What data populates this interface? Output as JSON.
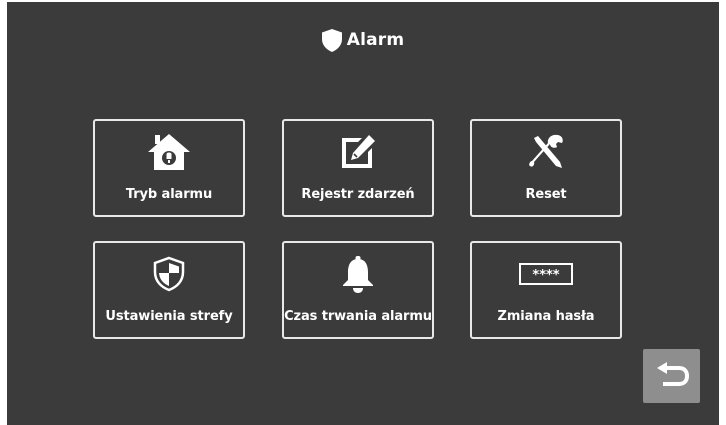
{
  "header": {
    "title": "Alarm",
    "icon": "shield-icon"
  },
  "tiles": [
    {
      "label": "Tryb alarmu",
      "icon": "house-alarm-icon"
    },
    {
      "label": "Rejestr zdarzeń",
      "icon": "edit-note-icon"
    },
    {
      "label": "Reset",
      "icon": "tools-icon"
    },
    {
      "label": "Ustawienia strefy",
      "icon": "zone-shield-icon"
    },
    {
      "label": "Czas trwania alarmu",
      "icon": "bell-icon"
    },
    {
      "label": "Zmiana hasła",
      "icon": "password-field-icon",
      "icon_text": "****"
    }
  ],
  "back_button": {
    "icon": "return-arrow-icon"
  },
  "colors": {
    "background": "#3b3b3b",
    "tile_border": "#e8e8e8",
    "text": "#ffffff",
    "back_button": "#8e8e8e"
  }
}
